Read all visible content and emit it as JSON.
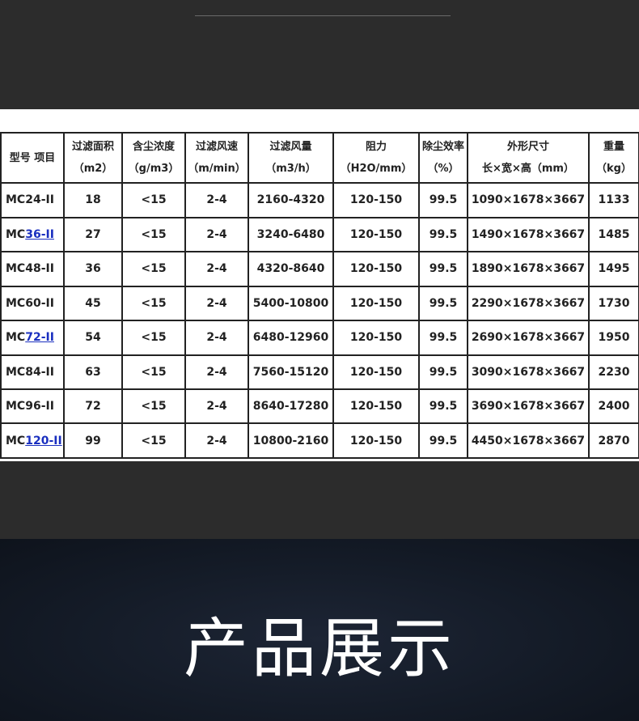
{
  "table": {
    "header": [
      [
        "型号 项目"
      ],
      [
        "过滤面积",
        "（m2）"
      ],
      [
        "含尘浓度",
        "（g/m3）"
      ],
      [
        "过滤风速",
        "（m/min）"
      ],
      [
        "过滤风量",
        "（m3/h）"
      ],
      [
        "阻力",
        "（H2O/mm）"
      ],
      [
        "除尘效率",
        "（%）"
      ],
      [
        "外形尺寸",
        "长×宽×高（mm）"
      ],
      [
        "重量",
        "（kg）"
      ]
    ],
    "rows": [
      {
        "model_prefix": "MC24-II",
        "model_link": "",
        "cells": [
          "18",
          "<15",
          "2-4",
          "2160-4320",
          "120-150",
          "99.5",
          "1090×1678×3667",
          "1133"
        ]
      },
      {
        "model_prefix": "MC",
        "model_link": "36-II",
        "cells": [
          "27",
          "<15",
          "2-4",
          "3240-6480",
          "120-150",
          "99.5",
          "1490×1678×3667",
          "1485"
        ]
      },
      {
        "model_prefix": "MC48-II",
        "model_link": "",
        "cells": [
          "36",
          "<15",
          "2-4",
          "4320-8640",
          "120-150",
          "99.5",
          "1890×1678×3667",
          "1495"
        ]
      },
      {
        "model_prefix": "MC60-II",
        "model_link": "",
        "cells": [
          "45",
          "<15",
          "2-4",
          "5400-10800",
          "120-150",
          "99.5",
          "2290×1678×3667",
          "1730"
        ]
      },
      {
        "model_prefix": "MC",
        "model_link": "72-II",
        "cells": [
          "54",
          "<15",
          "2-4",
          "6480-12960",
          "120-150",
          "99.5",
          "2690×1678×3667",
          "1950"
        ]
      },
      {
        "model_prefix": "MC84-II",
        "model_link": "",
        "cells": [
          "63",
          "<15",
          "2-4",
          "7560-15120",
          "120-150",
          "99.5",
          "3090×1678×3667",
          "2230"
        ]
      },
      {
        "model_prefix": "MC96-II",
        "model_link": "",
        "cells": [
          "72",
          "<15",
          "2-4",
          "8640-17280",
          "120-150",
          "99.5",
          "3690×1678×3667",
          "2400"
        ]
      },
      {
        "model_prefix": "MC",
        "model_link": "120-II",
        "cells": [
          "99",
          "<15",
          "2-4",
          "10800-2160",
          "120-150",
          "99.5",
          "4450×1678×3667",
          "2870"
        ]
      }
    ]
  },
  "hero": {
    "title": "产品展示"
  },
  "colors": {
    "link": "#1a2fbf",
    "band": "#2c2c2c",
    "hero_bg": "#141b27"
  }
}
